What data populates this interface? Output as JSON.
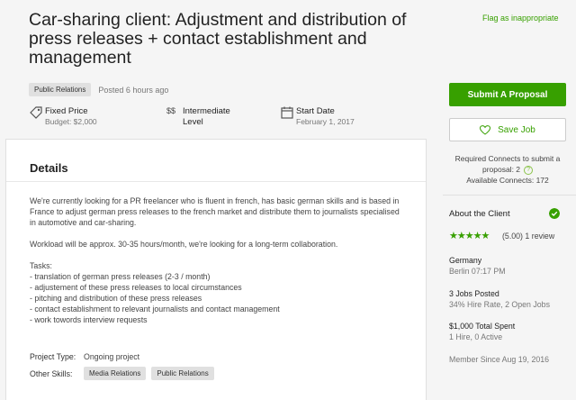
{
  "job": {
    "title": "Car-sharing client: Adjustment and distribution of press releases + contact establishment and management",
    "flag_label": "Flag as inappropriate",
    "category_tag": "Public Relations",
    "posted": "Posted 6 hours ago"
  },
  "specs": [
    {
      "icon": "price-tag-icon",
      "label": "Fixed Price",
      "sub": "Budget: $2,000"
    },
    {
      "icon": "dollar-level-icon",
      "icon_text": "$$",
      "label": "Intermediate",
      "sub": "Level"
    },
    {
      "icon": "calendar-icon",
      "label": "Start Date",
      "sub": "February 1, 2017"
    }
  ],
  "details": {
    "heading": "Details",
    "paragraphs": [
      "We're currently looking for a PR freelancer who is fluent in french, has basic german skills  and is based in France to adjust german press releases to the french market and distribute them to journalists specialised in automotive and car-sharing.",
      "Workload will be approx. 30-35 hours/month, we're looking for a long-term collaboration.",
      "Tasks:\n- translation of german press releases (2-3 / month)\n- adjustement of these press releases to local circumstances\n- pitching and distribution of these press releases\n- contact establishment to relevant journalists and contact management\n- work towords interview requests"
    ],
    "project_type_label": "Project Type:",
    "project_type_value": "Ongoing project",
    "other_skills_label": "Other Skills:",
    "other_skills": [
      "Media Relations",
      "Public Relations"
    ]
  },
  "sidebar": {
    "submit_label": "Submit A Proposal",
    "save_label": "Save Job",
    "connects_line1": "Required Connects to submit a",
    "connects_line2": "proposal: 2",
    "connects_line3": "Available Connects: 172",
    "about_client": "About the Client",
    "stars": "★★★★★",
    "rating_text": "(5.00) 1 review",
    "country": "Germany",
    "city_time": "Berlin 07:17 PM",
    "jobs_posted": "3 Jobs Posted",
    "hire_rate": "34% Hire Rate, 2 Open Jobs",
    "total_spent": "$1,000 Total Spent",
    "hires": "1 Hire, 0 Active",
    "member_since": "Member Since Aug 19, 2016"
  },
  "colors": {
    "accent": "#37a000",
    "tag_bg": "#e0e0e0"
  }
}
